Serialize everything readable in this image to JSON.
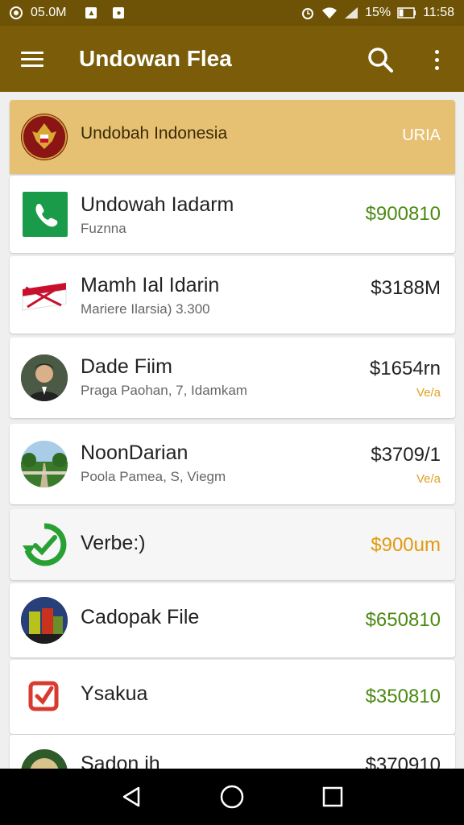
{
  "status": {
    "left_text": "05.0M",
    "battery": "15%",
    "time": "11:58",
    "icons": [
      "circle-badge-icon",
      "photo-icon",
      "message-icon",
      "alarm-icon",
      "wifi-icon",
      "signal-icon",
      "battery-icon"
    ]
  },
  "appbar": {
    "title": "Undowan Flea",
    "menu_icon": "hamburger-menu-icon",
    "search_icon": "search-icon",
    "more_icon": "more-vert-icon"
  },
  "colors": {
    "appbar": "#7a5c09",
    "statusbar": "#6e5306",
    "header_row": "#e7c173",
    "amount_green": "#4b8a12",
    "amount_orange": "#e09a10"
  },
  "rows": [
    {
      "name": "Undobah Indonesia",
      "sub": "",
      "amount": "URIA",
      "badge": "",
      "icon": "emblem-icon"
    },
    {
      "name": "Undowah Iadarm",
      "sub": "Fuznna",
      "amount": "$900810",
      "badge": "",
      "icon": "phone-app-icon"
    },
    {
      "name": "Mamh Ial Idarin",
      "sub": "Mariere Ilarsia) 3.300",
      "amount": "$3188M",
      "badge": "",
      "icon": "flag-icon"
    },
    {
      "name": "Dade Fiim",
      "sub": "Praga Paohan, 7, Idamkam",
      "amount": "$1654rn",
      "badge": "Ve/a",
      "icon": "person-avatar"
    },
    {
      "name": "NoonDarian",
      "sub": "Poola Pamea, S, Viegm",
      "amount": "$3709/1",
      "badge": "Ve/a",
      "icon": "road-photo-avatar"
    },
    {
      "name": "Verbe:)",
      "sub": "",
      "amount": "$900um",
      "badge": "",
      "icon": "refresh-check-icon"
    },
    {
      "name": "Cadopak File",
      "sub": "",
      "amount": "$650810",
      "badge": "",
      "icon": "cans-photo-avatar"
    },
    {
      "name": "Ysakua",
      "sub": "",
      "amount": "$350810",
      "badge": "",
      "icon": "check-box-icon"
    },
    {
      "name": "Sadon ih",
      "sub": "",
      "amount": "$370910",
      "badge": "",
      "icon": "emblem-avatar"
    }
  ],
  "nav": {
    "back_icon": "back-triangle-icon",
    "home_icon": "home-circle-icon",
    "recents_icon": "recents-square-icon"
  }
}
